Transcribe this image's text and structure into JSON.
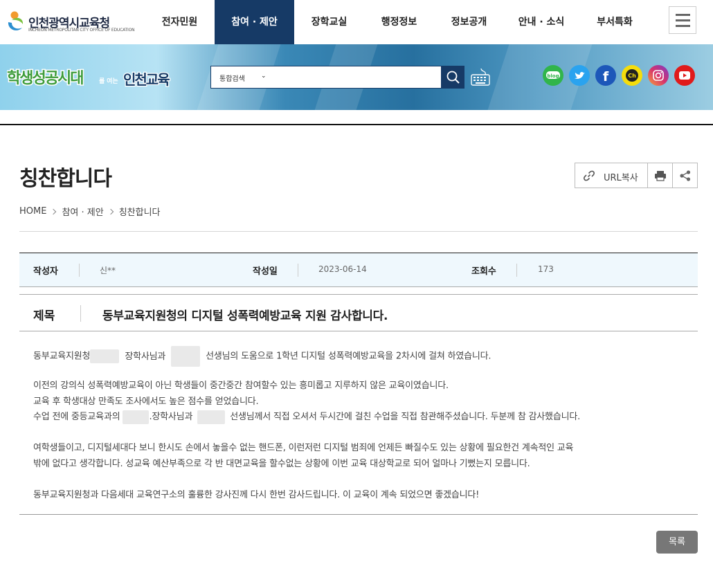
{
  "header": {
    "logo_title": "인천광역시교육청",
    "logo_subtitle": "INCHEON METROPOLITAN CITY OFFICE OF EDUCATION",
    "menu": [
      "전자민원",
      "참여 · 제안",
      "장학교실",
      "행정정보",
      "정보공개",
      "안내 · 소식",
      "부서특화"
    ],
    "active_menu_index": 1,
    "menu_icon": "hamburger-menu-icon"
  },
  "banner": {
    "slogan": "학생성공시대를 여는 인천교육",
    "search_select": "통합검색",
    "search_placeholder": "",
    "social": [
      {
        "name": "blog",
        "label": "blog",
        "color": "#31b54b"
      },
      {
        "name": "twitter",
        "label": "",
        "color": "#2aa3ef"
      },
      {
        "name": "facebook",
        "label": "f",
        "color": "#1d57b9"
      },
      {
        "name": "kakao-channel",
        "label": "Ch",
        "color": "#f5dd0c"
      },
      {
        "name": "instagram",
        "label": "",
        "color": "#d6336c"
      },
      {
        "name": "youtube",
        "label": "",
        "color": "#e01b1b"
      }
    ]
  },
  "page": {
    "title": "칭찬합니다",
    "url_copy_label": "URL복사",
    "breadcrumb": [
      "HOME",
      "참여 · 제안",
      "칭찬합니다"
    ]
  },
  "post": {
    "author_label": "작성자",
    "author": "신**",
    "date_label": "작성일",
    "date": "2023-06-14",
    "views_label": "조회수",
    "views": "173",
    "subject_label": "제목",
    "subject": "동부교육지원청의 디지털 성폭력예방교육 지원 감사합니다.",
    "p1a": "동부교육지원청",
    "p1b": "장학사님과",
    "p1c": "선생님의 도움으로 1학년 디지털 성폭력예방교육을 2차시에 걸쳐 하였습니다.",
    "p2": "이전의 강의식 성폭력예방교육이 아닌 학생들이 중간중간 참여할수 있는 흥미롭고 지루하지 않은 교육이였습니다.",
    "p3": "교육 후 학생대상 만족도 조사에서도 높은 점수를 얻었습니다.",
    "p4a": "수업 전에 중등교육과의",
    "p4b": ".장학사님과",
    "p4c": "선생님께서 직접 오셔서 두시간에 걸친 수업을 직접 참관해주셨습니다. 두분께 참 감사했습니다.",
    "p5": "여학생들이고, 디지털세대다 보니 한시도 손에서 놓을수 없는 핸드폰, 이런저런 디지털 범죄에 언제든 빠질수도 있는 상황에 필요한건 계속적인 교육",
    "p6": "밖에 없다고 생각합니다. 성교육 예산부족으로 각 반 대면교육을 할수없는 상황에 이번 교육 대상학교로 되어 얼마나 기뻤는지 모릅니다.",
    "p7": "동부교육지원청과 다음세대 교육연구소의 훌륭한 강사진께 다시 한번 감사드립니다. 이 교육이 계속 되었으면 좋겠습니다!",
    "list_button": "목록"
  }
}
